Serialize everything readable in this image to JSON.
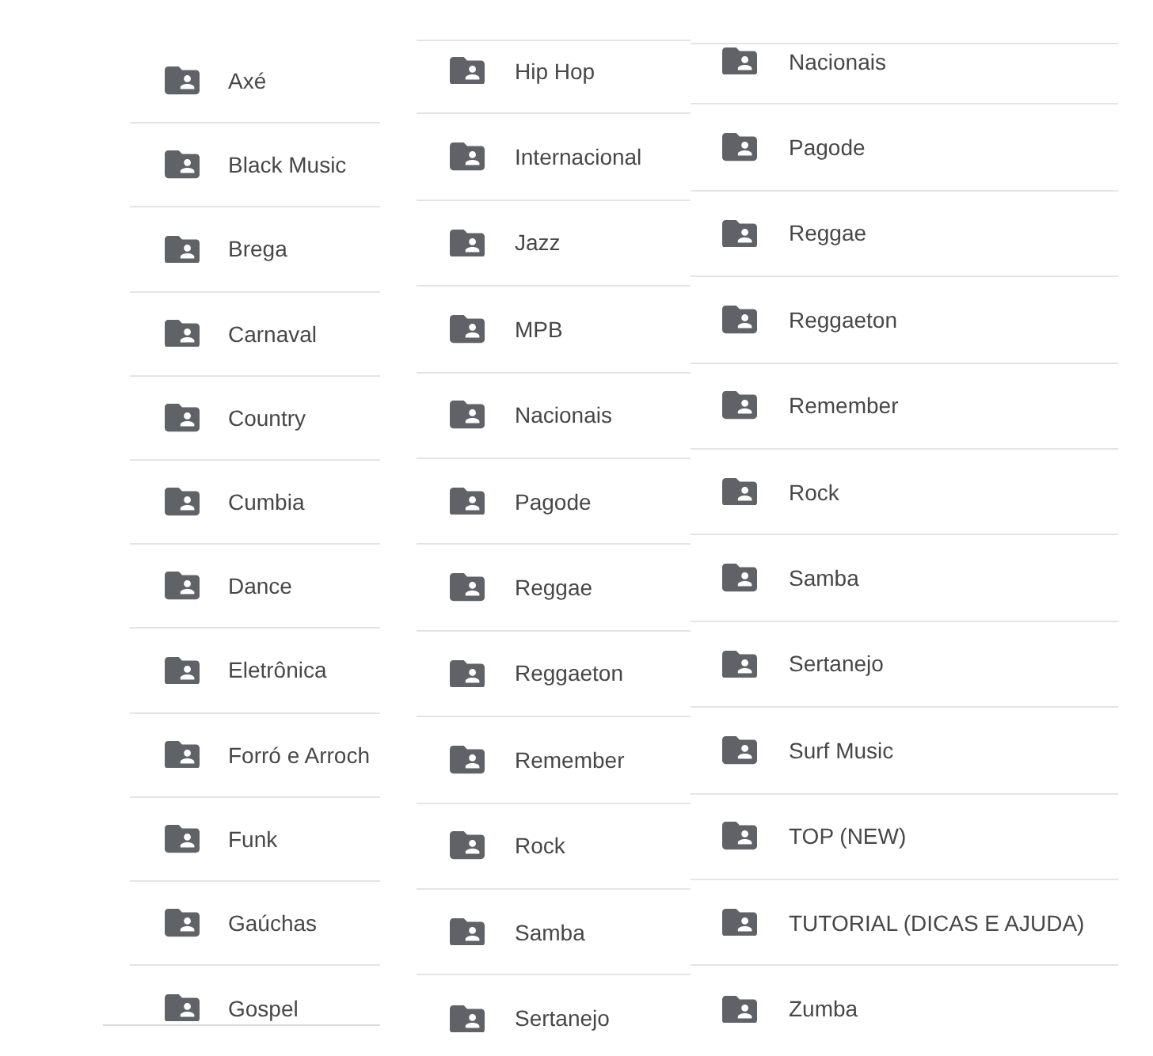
{
  "panels": [
    {
      "folders": [
        "Axé",
        "Black Music",
        "Brega",
        "Carnaval",
        "Country",
        "Cumbia",
        "Dance",
        "Eletrônica",
        "Forró e Arroch",
        "Funk",
        "Gaúchas",
        "Gospel"
      ]
    },
    {
      "folders": [
        "Hip Hop",
        "Internacional",
        "Jazz",
        "MPB",
        "Nacionais",
        "Pagode",
        "Reggae",
        "Reggaeton",
        "Remember",
        "Rock",
        "Samba",
        "Sertanejo"
      ]
    },
    {
      "folders": [
        "Nacionais",
        "Pagode",
        "Reggae",
        "Reggaeton",
        "Remember",
        "Rock",
        "Samba",
        "Sertanejo",
        "Surf Music",
        "TOP (NEW)",
        "TUTORIAL (DICAS E AJUDA)",
        "Zumba"
      ]
    }
  ]
}
